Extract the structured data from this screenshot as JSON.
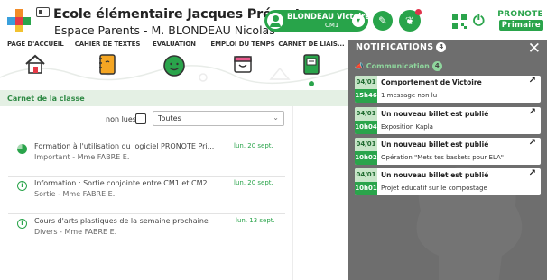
{
  "header": {
    "school": "Ecole élémentaire Jacques Prévert",
    "space": "Espace Parents - M. BLONDEAU Nicolas",
    "user_name": "BLONDEAU Victoire",
    "user_class": "CM1",
    "pronote_brand": "PRONOTE",
    "pronote_sub": "Primaire"
  },
  "nav": {
    "items": [
      {
        "label": "PAGE D'ACCUEIL",
        "icon": "house-icon"
      },
      {
        "label": "CAHIER DE TEXTES",
        "icon": "notebook-icon"
      },
      {
        "label": "EVALUATION",
        "icon": "smiley-icon"
      },
      {
        "label": "EMPLOI DU TEMPS",
        "icon": "calendar-icon"
      },
      {
        "label": "CARNET DE LIAIS...",
        "icon": "liaison-book-icon"
      }
    ]
  },
  "section": {
    "title": "Carnet de la classe"
  },
  "filter": {
    "unread_label": "non lues",
    "unread_checked": false,
    "select_value": "Toutes"
  },
  "items": [
    {
      "title": "Formation à l'utilisation du logiciel PRONOTE Pri...",
      "subtitle": "Important - Mme FABRE E.",
      "date": "lun. 20 sept.",
      "icon": "pie-icon"
    },
    {
      "title": "Information : Sortie conjointe entre CM1 et CM2",
      "subtitle": "Sortie - Mme FABRE E.",
      "date": "lun. 20 sept.",
      "icon": "info-icon"
    },
    {
      "title": "Cours d'arts plastiques de la semaine prochaine",
      "subtitle": "Divers - Mme FABRE E.",
      "date": "lun. 13 sept.",
      "icon": "info-icon"
    }
  ],
  "notifications": {
    "title": "NOTIFICATIONS",
    "count": "4",
    "category": "Communication",
    "category_count": "4",
    "list": [
      {
        "date": "04/01",
        "time": "15h46",
        "title": "Comportement de Victoire",
        "detail": "1 message non lu"
      },
      {
        "date": "04/01",
        "time": "10h04",
        "title": "Un nouveau billet est publié",
        "detail": "Exposition Kapla"
      },
      {
        "date": "04/01",
        "time": "10h02",
        "title": "Un nouveau billet est publié",
        "detail": "Opération \"Mets tes baskets pour ELA\""
      },
      {
        "date": "04/01",
        "time": "10h01",
        "title": "Un nouveau billet est publié",
        "detail": "Projet éducatif sur le compostage"
      }
    ]
  },
  "colors": {
    "accent": "#2aa44b",
    "band": "#e4f0e4",
    "panel": "#6e6e6e"
  }
}
